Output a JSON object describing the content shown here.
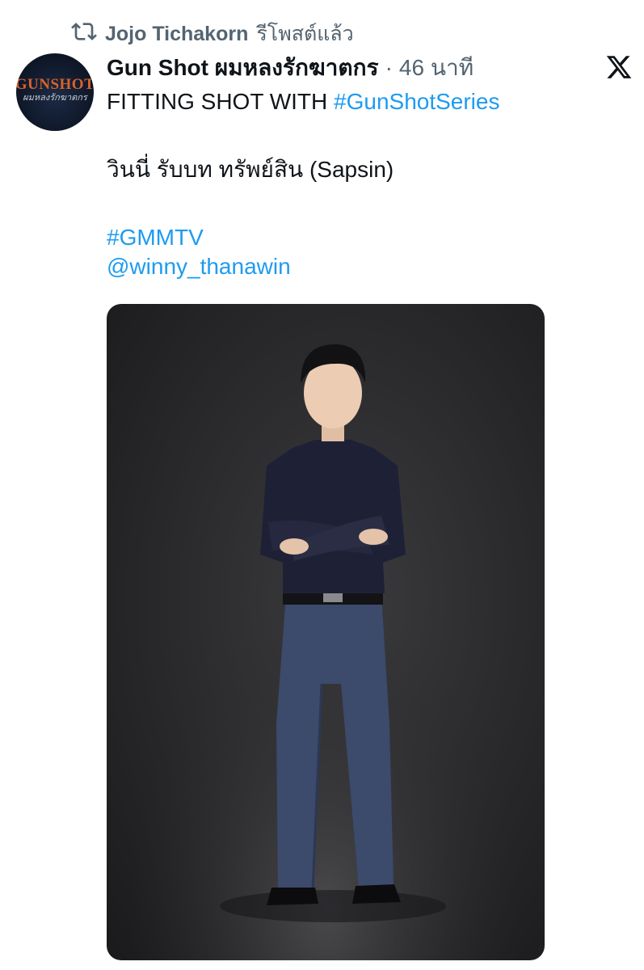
{
  "retweet": {
    "icon": "retweet-icon",
    "user": "Jojo Tichakorn",
    "action": "รีโพสต์แล้ว"
  },
  "post": {
    "avatar": {
      "logo_main": "GUNSHOT",
      "logo_sub": "ผมหลงรักฆาตกร"
    },
    "author": "Gun Shot ผมหลงรักฆาตกร",
    "separator": "·",
    "time": "46 นาที",
    "body": {
      "line1_text": "FITTING SHOT WITH ",
      "line1_hashtag": "#GunShotSeries",
      "line2": "วินนี่ รับบท ทรัพย์สิน (Sapsin)",
      "hashtag2": "#GMMTV",
      "mention": "@winny_thanawin"
    },
    "media_icon": "photo-actor-fullbody"
  },
  "colors": {
    "link": "#1d9bf0",
    "muted": "#536471",
    "text": "#0f1419"
  }
}
